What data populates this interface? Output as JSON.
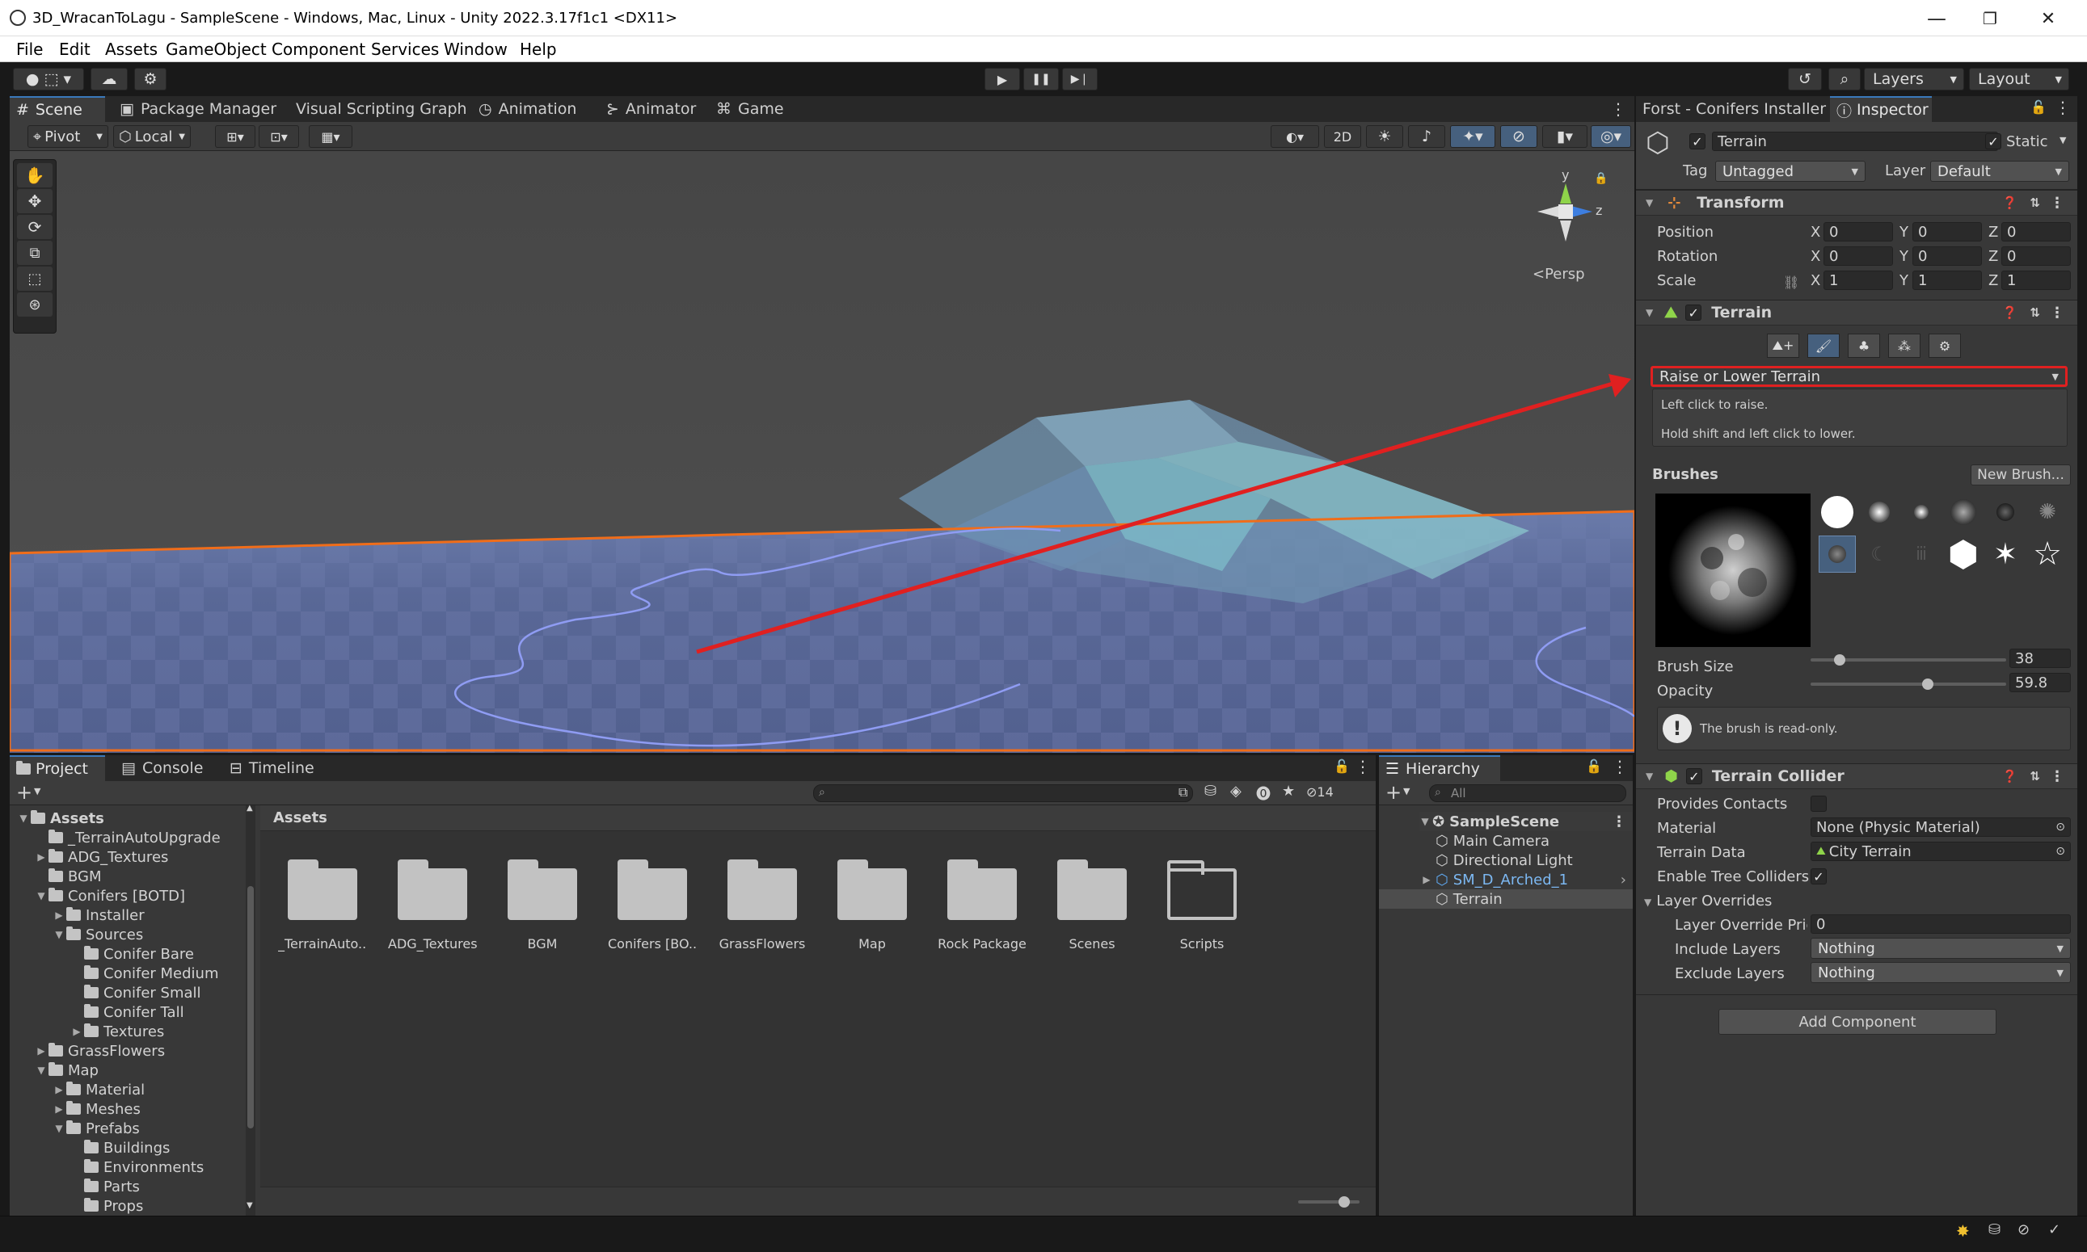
{
  "window": {
    "title": "3D_WracanToLagu - SampleScene - Windows, Mac, Linux - Unity 2022.3.17f1c1 <DX11>",
    "minimize": "—",
    "maximize": "❐",
    "close": "✕"
  },
  "menu": [
    "File",
    "Edit",
    "Assets",
    "GameObject",
    "Component",
    "Services",
    "Window",
    "Help"
  ],
  "toolbar": {
    "play": "▶",
    "pause": "❚❚",
    "step": "▶❘",
    "layers_label": "Layers",
    "layout_label": "Layout"
  },
  "scene_tabs": [
    "Scene",
    "Package Manager",
    "Visual Scripting Graph",
    "Animation",
    "Animator",
    "Game"
  ],
  "scene_toolbar": {
    "pivot": "Pivot",
    "local": "Local",
    "mode_2d": "2D"
  },
  "gizmo": {
    "y_axis": "y",
    "z_axis": "z",
    "persp": "Persp"
  },
  "project": {
    "tabs": [
      "Project",
      "Console",
      "Timeline"
    ],
    "add": "+",
    "search_placeholder": "",
    "hidden_count": "14",
    "breadcrumb": "Assets",
    "tree": [
      {
        "label": "Assets",
        "depth": 0,
        "expanded": true
      },
      {
        "label": "_TerrainAutoUpgrade",
        "depth": 1,
        "expanded": null
      },
      {
        "label": "ADG_Textures",
        "depth": 1,
        "expanded": false
      },
      {
        "label": "BGM",
        "depth": 1,
        "expanded": null
      },
      {
        "label": "Conifers [BOTD]",
        "depth": 1,
        "expanded": true
      },
      {
        "label": "Installer",
        "depth": 2,
        "expanded": false
      },
      {
        "label": "Sources",
        "depth": 2,
        "expanded": true
      },
      {
        "label": "Conifer Bare",
        "depth": 3,
        "expanded": null
      },
      {
        "label": "Conifer Medium",
        "depth": 3,
        "expanded": null
      },
      {
        "label": "Conifer Small",
        "depth": 3,
        "expanded": null
      },
      {
        "label": "Conifer Tall",
        "depth": 3,
        "expanded": null
      },
      {
        "label": "Textures",
        "depth": 3,
        "expanded": false
      },
      {
        "label": "GrassFlowers",
        "depth": 1,
        "expanded": false
      },
      {
        "label": "Map",
        "depth": 1,
        "expanded": true
      },
      {
        "label": "Material",
        "depth": 2,
        "expanded": false
      },
      {
        "label": "Meshes",
        "depth": 2,
        "expanded": false
      },
      {
        "label": "Prefabs",
        "depth": 2,
        "expanded": true
      },
      {
        "label": "Buildings",
        "depth": 3,
        "expanded": null
      },
      {
        "label": "Environments",
        "depth": 3,
        "expanded": null
      },
      {
        "label": "Parts",
        "depth": 3,
        "expanded": null
      },
      {
        "label": "Props",
        "depth": 3,
        "expanded": null
      }
    ],
    "grid": [
      {
        "label": "_TerrainAuto...",
        "outline": false
      },
      {
        "label": "ADG_Textures",
        "outline": false
      },
      {
        "label": "BGM",
        "outline": false
      },
      {
        "label": "Conifers [BO...",
        "outline": false
      },
      {
        "label": "GrassFlowers",
        "outline": false
      },
      {
        "label": "Map",
        "outline": false
      },
      {
        "label": "Rock Package",
        "outline": false
      },
      {
        "label": "Scenes",
        "outline": false
      },
      {
        "label": "Scripts",
        "outline": true
      }
    ]
  },
  "hierarchy": {
    "tab": "Hierarchy",
    "add": "+",
    "search_placeholder": "All",
    "scene": "SampleScene",
    "items": [
      {
        "label": "Main Camera",
        "prefab": false,
        "selected": false
      },
      {
        "label": "Directional Light",
        "prefab": false,
        "selected": false
      },
      {
        "label": "SM_D_Arched_1",
        "prefab": true,
        "selected": false
      },
      {
        "label": "Terrain",
        "prefab": false,
        "selected": true
      }
    ]
  },
  "inspector": {
    "tabs": [
      "Forst - Conifers Installer",
      "Inspector"
    ],
    "object_name": "Terrain",
    "static_label": "Static",
    "tag_label": "Tag",
    "tag_value": "Untagged",
    "layer_label": "Layer",
    "layer_value": "Default",
    "transform": {
      "title": "Transform",
      "rows": [
        {
          "label": "Position",
          "x": "0",
          "y": "0",
          "z": "0"
        },
        {
          "label": "Rotation",
          "x": "0",
          "y": "0",
          "z": "0"
        },
        {
          "label": "Scale",
          "x": "1",
          "y": "1",
          "z": "1"
        }
      ],
      "axis": [
        "X",
        "Y",
        "Z"
      ]
    },
    "terrain": {
      "title": "Terrain",
      "tool_dropdown": "Raise or Lower Terrain",
      "help_line1": "Left click to raise.",
      "help_line2": "Hold shift and left click to lower.",
      "brushes_label": "Brushes",
      "new_brush": "New Brush...",
      "brush_size_label": "Brush Size",
      "brush_size": "38",
      "brush_size_frac": 0.15,
      "opacity_label": "Opacity",
      "opacity": "59.8",
      "opacity_frac": 0.6,
      "readonly_note": "The brush is read-only."
    },
    "collider": {
      "title": "Terrain Collider",
      "provides_contacts": "Provides Contacts",
      "material_label": "Material",
      "material_value": "None (Physic Material)",
      "terrain_data_label": "Terrain Data",
      "terrain_data_value": "City Terrain",
      "enable_tree_label": "Enable Tree Colliders",
      "layer_overrides": "Layer Overrides",
      "layer_override_priority_label": "Layer Override Pric",
      "layer_override_priority": "0",
      "include_layers_label": "Include Layers",
      "include_layers_value": "Nothing",
      "exclude_layers_label": "Exclude Layers",
      "exclude_layers_value": "Nothing"
    },
    "add_component": "Add Component"
  },
  "colors": {
    "accent": "#3a79bb",
    "highlight_red": "#e02020",
    "terrain_orange": "#f06d1a"
  }
}
